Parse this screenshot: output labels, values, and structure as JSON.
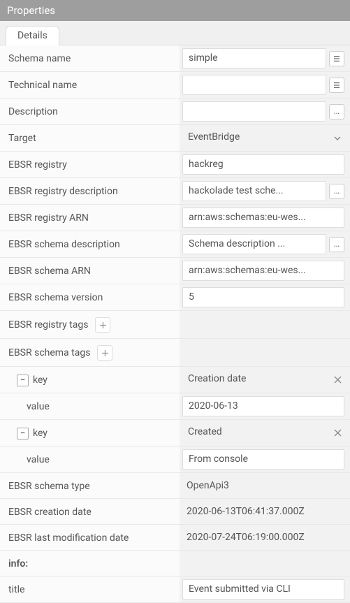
{
  "panel": {
    "title": "Properties"
  },
  "tabs": {
    "details": "Details"
  },
  "labels": {
    "schemaName": "Schema name",
    "technicalName": "Technical name",
    "description": "Description",
    "target": "Target",
    "ebsrRegistry": "EBSR registry",
    "ebsrRegistryDescription": "EBSR registry description",
    "ebsrRegistryArn": "EBSR registry ARN",
    "ebsrSchemaDescription": "EBSR schema description",
    "ebsrSchemaArn": "EBSR schema ARN",
    "ebsrSchemaVersion": "EBSR schema version",
    "ebsrRegistryTags": "EBSR registry tags",
    "ebsrSchemaTags": "EBSR schema tags",
    "key": "key",
    "value": "value",
    "ebsrSchemaType": "EBSR schema type",
    "ebsrCreationDate": "EBSR creation date",
    "ebsrLastModificationDate": "EBSR last modification date",
    "info": "info:",
    "title": "title"
  },
  "values": {
    "schemaName": "simple",
    "technicalName": "",
    "description": "",
    "target": "EventBridge",
    "ebsrRegistry": "hackreg",
    "ebsrRegistryDescription": "hackolade test sche...",
    "ebsrRegistryArn": "arn:aws:schemas:eu-wes...",
    "ebsrSchemaDescription": "Schema description ...",
    "ebsrSchemaArn": "arn:aws:schemas:eu-wes...",
    "ebsrSchemaVersion": "5",
    "ebsrSchemaType": "OpenApi3",
    "ebsrCreationDate": "2020-06-13T06:41:37.000Z",
    "ebsrLastModificationDate": "2020-07-24T06:19:00.000Z",
    "title": "Event submitted via CLI"
  },
  "schemaTags": [
    {
      "key": "Creation date",
      "value": "2020-06-13"
    },
    {
      "key": "Created",
      "value": "From console"
    }
  ]
}
